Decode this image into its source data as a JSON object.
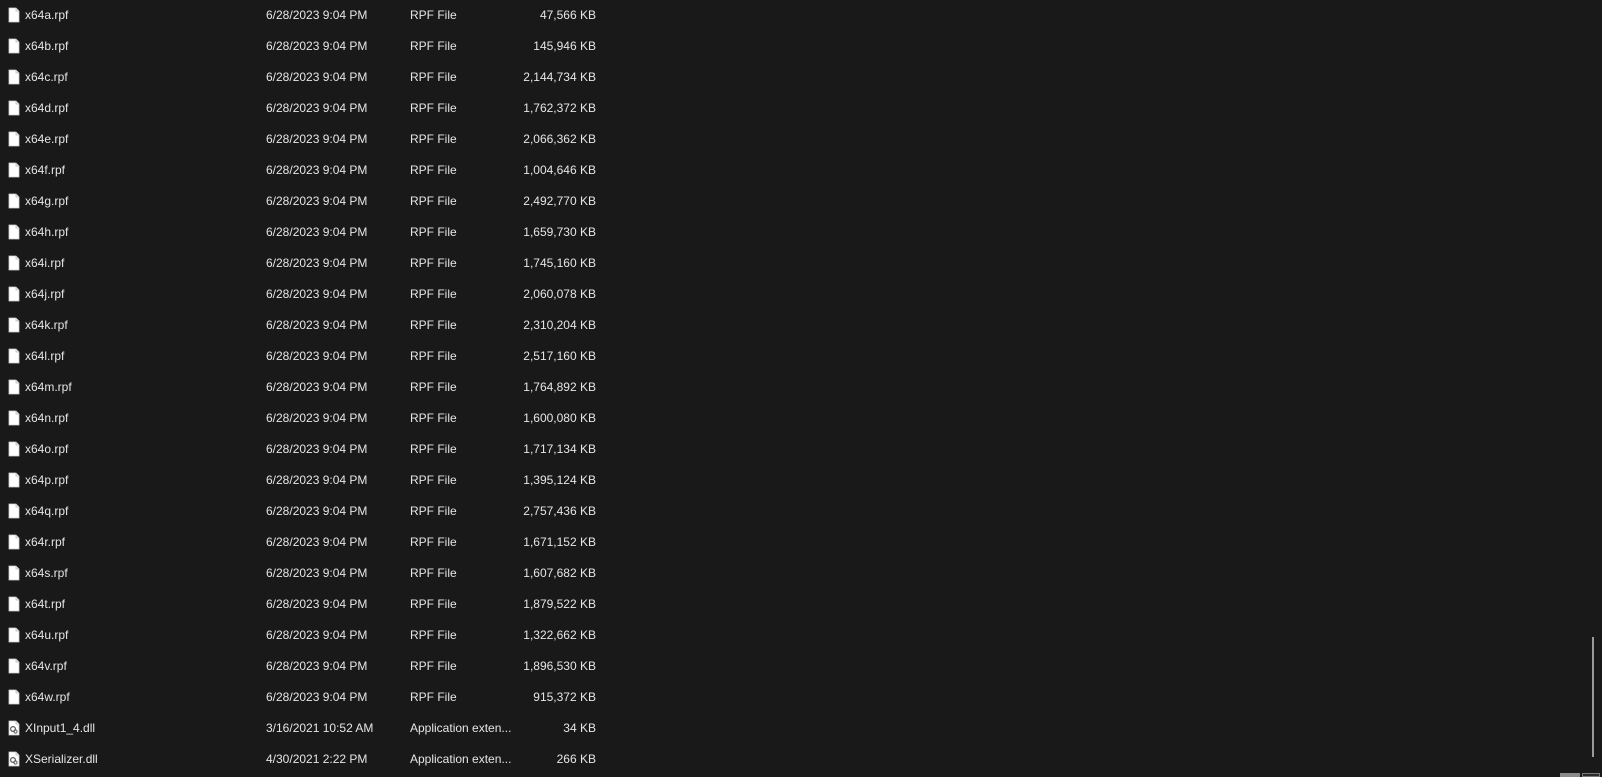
{
  "files": [
    {
      "name": "x64a.rpf",
      "date": "6/28/2023 9:04 PM",
      "type": "RPF File",
      "size": "47,566 KB",
      "icon": "blank-file-icon"
    },
    {
      "name": "x64b.rpf",
      "date": "6/28/2023 9:04 PM",
      "type": "RPF File",
      "size": "145,946 KB",
      "icon": "blank-file-icon"
    },
    {
      "name": "x64c.rpf",
      "date": "6/28/2023 9:04 PM",
      "type": "RPF File",
      "size": "2,144,734 KB",
      "icon": "blank-file-icon"
    },
    {
      "name": "x64d.rpf",
      "date": "6/28/2023 9:04 PM",
      "type": "RPF File",
      "size": "1,762,372 KB",
      "icon": "blank-file-icon"
    },
    {
      "name": "x64e.rpf",
      "date": "6/28/2023 9:04 PM",
      "type": "RPF File",
      "size": "2,066,362 KB",
      "icon": "blank-file-icon"
    },
    {
      "name": "x64f.rpf",
      "date": "6/28/2023 9:04 PM",
      "type": "RPF File",
      "size": "1,004,646 KB",
      "icon": "blank-file-icon"
    },
    {
      "name": "x64g.rpf",
      "date": "6/28/2023 9:04 PM",
      "type": "RPF File",
      "size": "2,492,770 KB",
      "icon": "blank-file-icon"
    },
    {
      "name": "x64h.rpf",
      "date": "6/28/2023 9:04 PM",
      "type": "RPF File",
      "size": "1,659,730 KB",
      "icon": "blank-file-icon"
    },
    {
      "name": "x64i.rpf",
      "date": "6/28/2023 9:04 PM",
      "type": "RPF File",
      "size": "1,745,160 KB",
      "icon": "blank-file-icon"
    },
    {
      "name": "x64j.rpf",
      "date": "6/28/2023 9:04 PM",
      "type": "RPF File",
      "size": "2,060,078 KB",
      "icon": "blank-file-icon"
    },
    {
      "name": "x64k.rpf",
      "date": "6/28/2023 9:04 PM",
      "type": "RPF File",
      "size": "2,310,204 KB",
      "icon": "blank-file-icon"
    },
    {
      "name": "x64l.rpf",
      "date": "6/28/2023 9:04 PM",
      "type": "RPF File",
      "size": "2,517,160 KB",
      "icon": "blank-file-icon"
    },
    {
      "name": "x64m.rpf",
      "date": "6/28/2023 9:04 PM",
      "type": "RPF File",
      "size": "1,764,892 KB",
      "icon": "blank-file-icon"
    },
    {
      "name": "x64n.rpf",
      "date": "6/28/2023 9:04 PM",
      "type": "RPF File",
      "size": "1,600,080 KB",
      "icon": "blank-file-icon"
    },
    {
      "name": "x64o.rpf",
      "date": "6/28/2023 9:04 PM",
      "type": "RPF File",
      "size": "1,717,134 KB",
      "icon": "blank-file-icon"
    },
    {
      "name": "x64p.rpf",
      "date": "6/28/2023 9:04 PM",
      "type": "RPF File",
      "size": "1,395,124 KB",
      "icon": "blank-file-icon"
    },
    {
      "name": "x64q.rpf",
      "date": "6/28/2023 9:04 PM",
      "type": "RPF File",
      "size": "2,757,436 KB",
      "icon": "blank-file-icon"
    },
    {
      "name": "x64r.rpf",
      "date": "6/28/2023 9:04 PM",
      "type": "RPF File",
      "size": "1,671,152 KB",
      "icon": "blank-file-icon"
    },
    {
      "name": "x64s.rpf",
      "date": "6/28/2023 9:04 PM",
      "type": "RPF File",
      "size": "1,607,682 KB",
      "icon": "blank-file-icon"
    },
    {
      "name": "x64t.rpf",
      "date": "6/28/2023 9:04 PM",
      "type": "RPF File",
      "size": "1,879,522 KB",
      "icon": "blank-file-icon"
    },
    {
      "name": "x64u.rpf",
      "date": "6/28/2023 9:04 PM",
      "type": "RPF File",
      "size": "1,322,662 KB",
      "icon": "blank-file-icon"
    },
    {
      "name": "x64v.rpf",
      "date": "6/28/2023 9:04 PM",
      "type": "RPF File",
      "size": "1,896,530 KB",
      "icon": "blank-file-icon"
    },
    {
      "name": "x64w.rpf",
      "date": "6/28/2023 9:04 PM",
      "type": "RPF File",
      "size": "915,372 KB",
      "icon": "blank-file-icon"
    },
    {
      "name": "XInput1_4.dll",
      "date": "3/16/2021 10:52 AM",
      "type": "Application exten...",
      "size": "34 KB",
      "icon": "dll-file-icon"
    },
    {
      "name": "XSerializer.dll",
      "date": "4/30/2021 2:22 PM",
      "type": "Application exten...",
      "size": "266 KB",
      "icon": "dll-file-icon"
    }
  ],
  "colors": {
    "background": "#191919",
    "text": "#e6e6e6",
    "scroll_thumb": "#9a9a9a"
  }
}
